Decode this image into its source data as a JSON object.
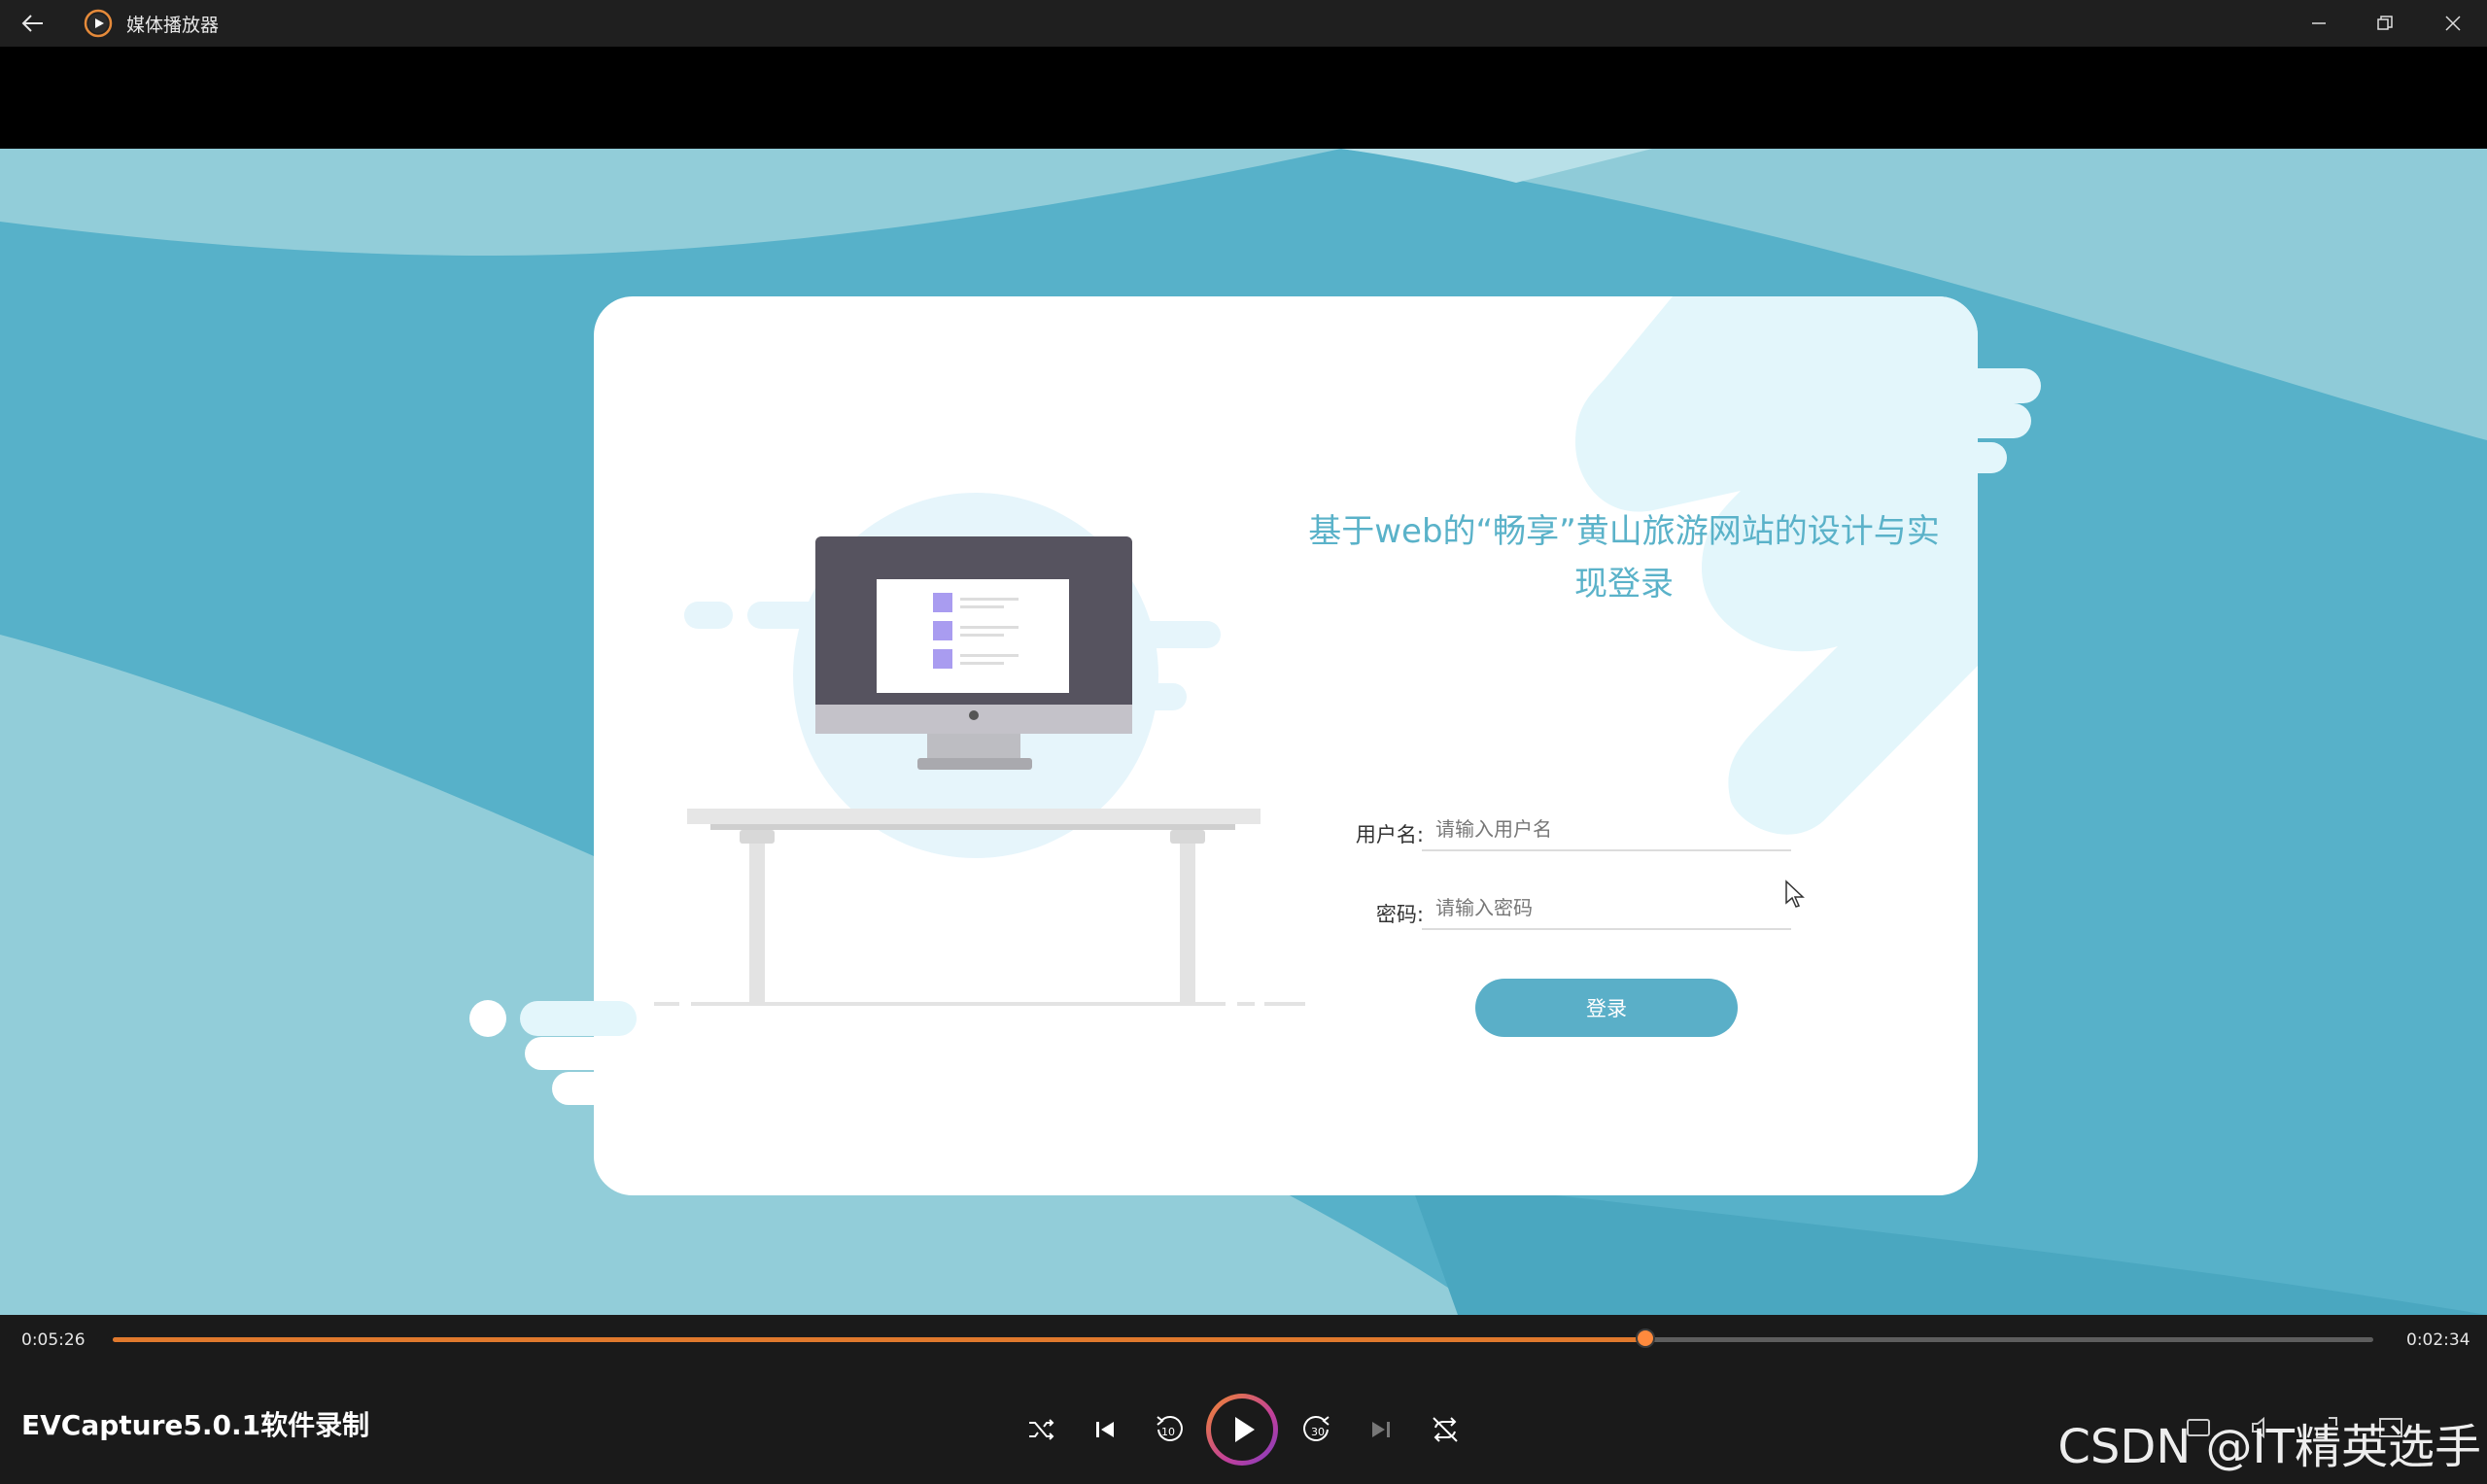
{
  "window": {
    "title": "媒体播放器"
  },
  "page": {
    "heading_line1": "基于web的“畅享”黄山旅游网站的设计与实",
    "heading_line2": "现登录",
    "username_label": "用户名:",
    "username_placeholder": "请输入用户名",
    "password_label": "密码:",
    "password_placeholder": "请输入密码",
    "login_button": "登录"
  },
  "player": {
    "elapsed": "0:05:26",
    "remaining": "0:02:34",
    "progress": 0.678,
    "media_title": "EVCapture5.0.1软件录制",
    "skip_back_seconds": "10",
    "skip_forward_seconds": "30"
  },
  "watermark": "CSDN @IT精英选手",
  "colors": {
    "accent": "#e0792d",
    "login_blue": "#5aafc8",
    "bg_teal": "#57b1c9"
  }
}
